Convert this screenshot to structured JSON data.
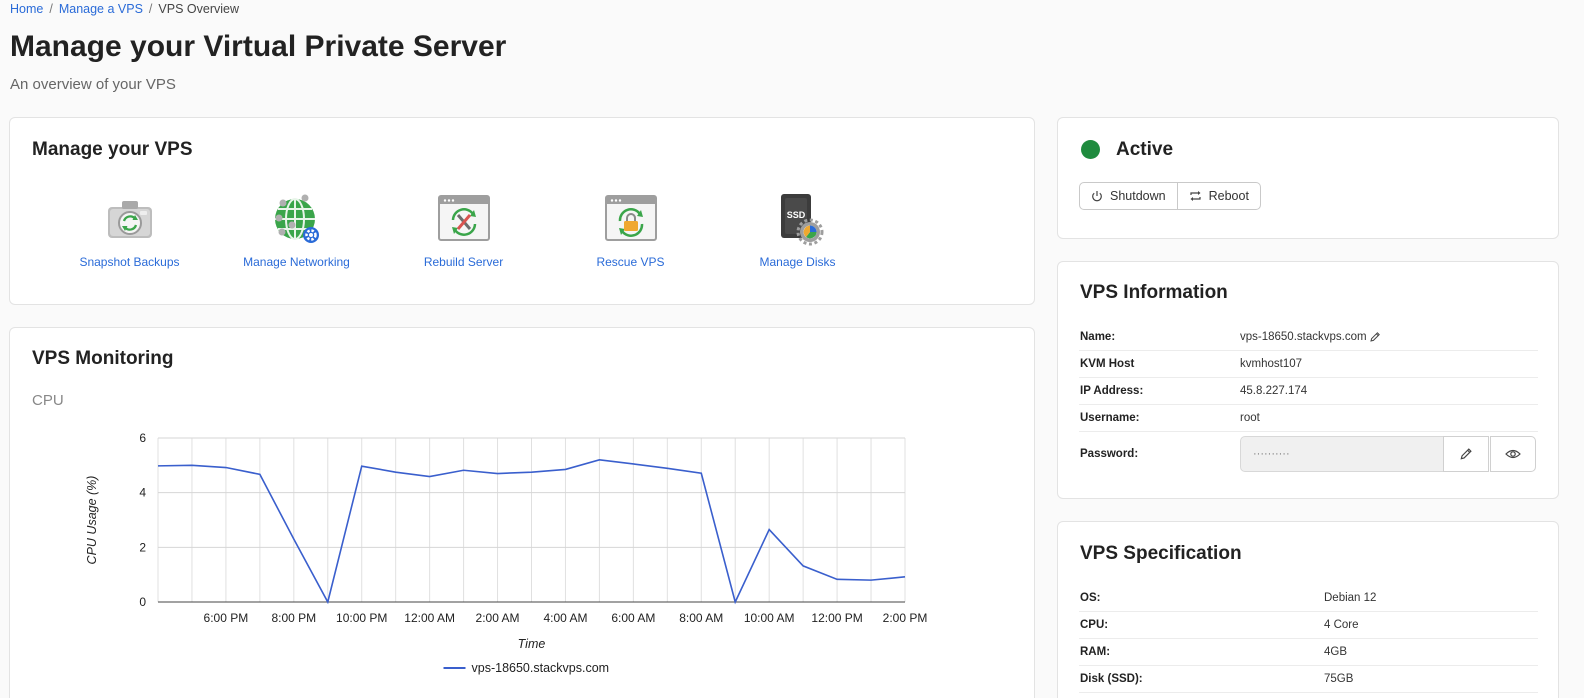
{
  "breadcrumb": {
    "home": "Home",
    "manage": "Manage a VPS",
    "current": "VPS Overview",
    "sep": "/"
  },
  "page": {
    "title": "Manage your Virtual Private Server",
    "subtitle": "An overview of your VPS"
  },
  "manage": {
    "title": "Manage your VPS",
    "tiles": [
      {
        "label": "Snapshot Backups",
        "icon": "camera-icon"
      },
      {
        "label": "Manage Networking",
        "icon": "globe-network-icon"
      },
      {
        "label": "Rebuild Server",
        "icon": "rebuild-tools-icon"
      },
      {
        "label": "Rescue VPS",
        "icon": "rescue-lock-icon"
      },
      {
        "label": "Manage Disks",
        "icon": "ssd-disk-icon"
      }
    ],
    "ssd_text": "SSD"
  },
  "monitoring": {
    "title": "VPS Monitoring",
    "cpu_label": "CPU"
  },
  "status": {
    "text": "Active",
    "color": "#1f8b3e",
    "shutdown": "Shutdown",
    "reboot": "Reboot"
  },
  "info": {
    "title": "VPS Information",
    "rows": [
      {
        "key": "Name:",
        "value": "vps-18650.stackvps.com"
      },
      {
        "key": "KVM Host",
        "value": "kvmhost107"
      },
      {
        "key": "IP Address:",
        "value": "45.8.227.174"
      },
      {
        "key": "Username:",
        "value": "root"
      }
    ],
    "password_key": "Password:",
    "password_value": "··········"
  },
  "spec": {
    "title": "VPS Specification",
    "rows": [
      {
        "key": "OS:",
        "value": "Debian 12"
      },
      {
        "key": "CPU:",
        "value": "4 Core"
      },
      {
        "key": "RAM:",
        "value": "4GB"
      },
      {
        "key": "Disk (SSD):",
        "value": "75GB"
      }
    ]
  },
  "chart_data": {
    "type": "line",
    "title": "",
    "xlabel": "Time",
    "ylabel": "CPU Usage (%)",
    "ylim": [
      0,
      6
    ],
    "yticks": [
      0,
      2,
      4,
      6
    ],
    "xticks": [
      "6:00 PM",
      "8:00 PM",
      "10:00 PM",
      "12:00 AM",
      "2:00 AM",
      "4:00 AM",
      "6:00 AM",
      "8:00 AM",
      "10:00 AM",
      "12:00 PM",
      "2:00 PM"
    ],
    "x_hours": [
      -2,
      -1,
      0,
      1,
      2,
      3,
      4,
      5,
      6,
      7,
      8,
      9,
      10,
      11,
      12,
      13,
      14,
      15,
      16,
      17,
      18,
      19,
      20
    ],
    "grid": true,
    "legend_position": "bottom",
    "color": "#3a5fcd",
    "series": [
      {
        "name": "vps-18650.stackvps.com",
        "values": [
          4.98,
          5.0,
          4.92,
          4.67,
          2.3,
          0.0,
          4.97,
          4.75,
          4.59,
          4.82,
          4.7,
          4.75,
          4.85,
          5.2,
          5.05,
          4.89,
          4.71,
          0.0,
          2.65,
          1.32,
          0.83,
          0.8,
          0.92
        ]
      }
    ]
  }
}
